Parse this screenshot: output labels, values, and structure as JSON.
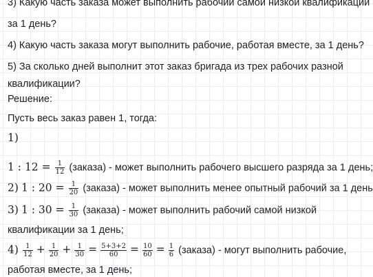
{
  "lines": {
    "l1": "3) Какую часть заказа может выполнить рабочий самой низкой квалификации",
    "l2": "за 1 день?",
    "l3": "4) Какую часть заказа могут выполнить рабочие, работая вместе, за 1 день?",
    "l4": "5) За сколько дней выполнит этот заказ бригада из трех рабочих разной",
    "l5": "квалификации?",
    "l6": "Решение:",
    "l7": "Пусть весь заказ равен 1, тогда:",
    "l8": "1)"
  },
  "step1": {
    "math": "1 : 12 =",
    "num": "1",
    "den": "12",
    "text": "(заказа) - может выполнить рабочего высшего разряда за 1 день;"
  },
  "step2": {
    "prefix": "2)",
    "math": "1 : 20 =",
    "num": "1",
    "den": "20",
    "text": "(заказа) - может выполнить менее опытный рабочий за 1 день;"
  },
  "step3": {
    "prefix": "3)",
    "math": "1 : 30 =",
    "num": "1",
    "den": "30",
    "text": "(заказа) - может выполнить рабочий самой низкой"
  },
  "step3b": "квалификации за 1 день;",
  "step4": {
    "prefix": "4)",
    "f1n": "1",
    "f1d": "12",
    "f2n": "1",
    "f2d": "20",
    "f3n": "1",
    "f3d": "30",
    "f4n": "5+3+2",
    "f4d": "60",
    "f5n": "10",
    "f5d": "60",
    "f6n": "1",
    "f6d": "6",
    "plus": "+",
    "eq": "=",
    "text": "(заказа) - могут выполнить рабочие,"
  },
  "step4b": "работая вместе, за 1 день;"
}
